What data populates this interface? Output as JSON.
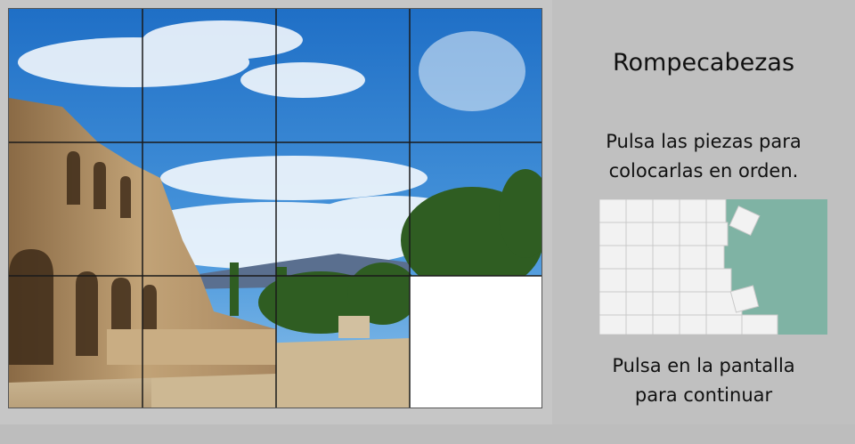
{
  "game": {
    "title": "Rompecabezas",
    "instruction_line1": "Pulsa las piezas para",
    "instruction_line2": "colocarlas en orden.",
    "continue_line1": "Pulsa en la pantalla",
    "continue_line2": "para continuar"
  },
  "puzzle": {
    "rows": 3,
    "cols": 4,
    "empty_tile": {
      "row": 3,
      "col": 4
    }
  },
  "colors": {
    "sky": "#2f7fd0",
    "stone": "#b99a6e",
    "trees": "#3e6e2a",
    "empty": "#ffffff",
    "grid": "#1a1a1a",
    "thumb_bg": "#7fb3a4"
  }
}
